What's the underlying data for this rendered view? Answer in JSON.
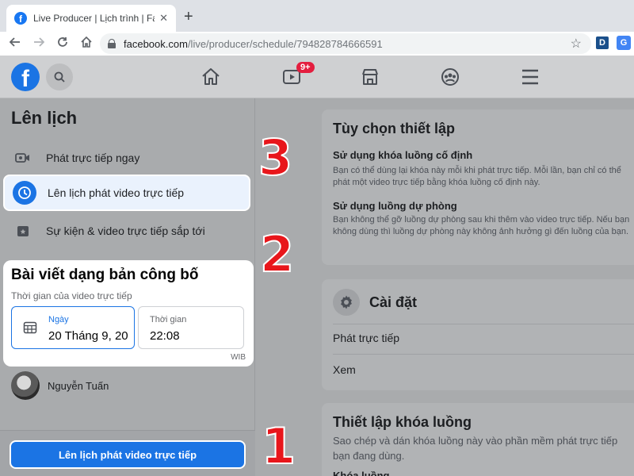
{
  "browser": {
    "tab_title": "Live Producer | Lịch trình | Facebo",
    "tab_close": "✕",
    "new_tab": "+",
    "url_host": "facebook.com",
    "url_path": "/live/producer/schedule/794828784666591",
    "ext_d": "D",
    "ext_translate": "G",
    "favicon": "f"
  },
  "fb_header": {
    "logo": "f",
    "watch_badge": "9+"
  },
  "sidebar": {
    "title": "Lên lịch",
    "items": [
      {
        "label": "Phát trực tiếp ngay",
        "icon": "video-camera-icon"
      },
      {
        "label": "Lên lịch phát video trực tiếp",
        "icon": "clock-icon",
        "active": true
      },
      {
        "label": "Sự kiện & video trực tiếp sắp tới",
        "icon": "calendar-star-icon"
      }
    ]
  },
  "public_post": {
    "title": "Bài viết dạng bản công bố",
    "subtitle": "Thời gian của video trực tiếp",
    "date_label": "Ngày",
    "date_value": "20 Tháng 9, 20",
    "time_label": "Thời gian",
    "time_value": "22:08",
    "timezone": "WIB"
  },
  "user": {
    "name": "Nguyễn Tuấn"
  },
  "footer": {
    "schedule_button": "Lên lịch phát video trực tiếp"
  },
  "steps": {
    "one": "1",
    "two": "2",
    "three": "3"
  },
  "setup_card": {
    "title": "Tùy chọn thiết lập",
    "persistent_key_title": "Sử dụng khóa luồng cố định",
    "persistent_key_desc": "Bạn có thể dùng lại khóa này mỗi khi phát trực tiếp. Mỗi lần, bạn chỉ có thể phát một video trực tiếp bằng khóa luồng cố định này.",
    "backup_title": "Sử dụng luồng dự phòng",
    "backup_desc": "Bạn không thể gỡ luồng dự phòng sau khi thêm vào video trực tiếp. Nếu bạn không dùng thì luồng dự phòng này không ảnh hưởng gì đến luồng của bạn."
  },
  "settings_card": {
    "title": "Cài đặt",
    "row1": "Phát trực tiếp",
    "row2": "Xem"
  },
  "stream_key_card": {
    "title": "Thiết lập khóa luồng",
    "desc": "Sao chép và dán khóa luồng này vào phần mềm phát trực tiếp bạn đang dùng.",
    "partial": "Khóa luồng"
  },
  "colors": {
    "brand": "#1b74e4",
    "step_red": "#e8161b",
    "overlay_gray": "#a9abad"
  }
}
